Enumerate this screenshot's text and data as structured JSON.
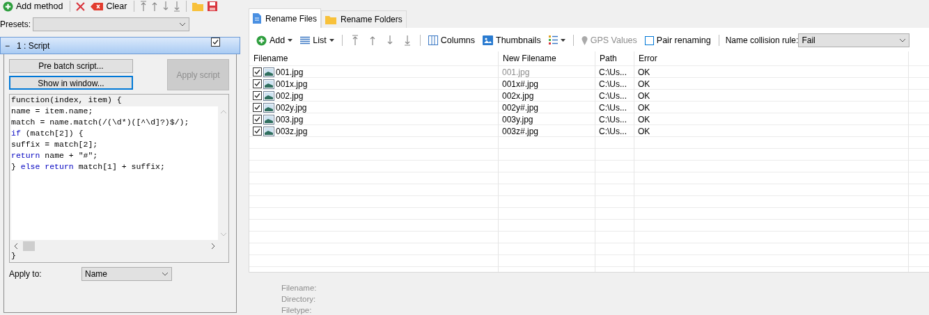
{
  "left_toolbar": {
    "add_method": "Add method",
    "clear": "Clear"
  },
  "presets": {
    "label": "Presets:"
  },
  "method": {
    "toggle": "−",
    "title": "1 : Script",
    "enabled": true,
    "buttons": [
      {
        "label": "Pre batch script...",
        "focused": false
      },
      {
        "label": "Show in window...",
        "focused": true
      }
    ],
    "apply_script": {
      "label": "Apply script",
      "disabled": true
    },
    "code_lines": [
      [
        {
          "text": "function(index, item) {"
        }
      ],
      [
        {
          "text": "name = item.name;"
        }
      ],
      [
        {
          "text": "match = name.match(/(\\d*)([^\\d]?)$/);"
        }
      ],
      [
        {
          "text": "if",
          "keyword": true
        },
        {
          "text": " (match[2]) {"
        }
      ],
      [
        {
          "text": "suffix = match[2];"
        }
      ],
      [
        {
          "text": "return",
          "keyword": true
        },
        {
          "text": " name + \"#\";"
        }
      ],
      [
        {
          "text": "} "
        },
        {
          "text": "else return",
          "keyword": true
        },
        {
          "text": " match[1] + suffix;"
        }
      ],
      [
        {
          "text": "}"
        }
      ]
    ],
    "apply_to": {
      "label": "Apply to:",
      "value": "Name"
    }
  },
  "tabs": [
    {
      "label": "Rename Files",
      "selected": true,
      "kind": "file"
    },
    {
      "label": "Rename Folders",
      "selected": false,
      "kind": "folder"
    }
  ],
  "toolbar": {
    "add": "Add",
    "list": "List",
    "columns": "Columns",
    "thumbnails": "Thumbnails",
    "gps": {
      "label": "GPS Values",
      "disabled": true
    },
    "pair_renaming": {
      "label": "Pair renaming",
      "checked": false
    },
    "collision": {
      "label": "Name collision rule:",
      "value": "Fail"
    }
  },
  "table": {
    "columns": [
      "Filename",
      "New Filename",
      "Path",
      "Error"
    ],
    "rows": [
      {
        "checked": true,
        "filename": "001.jpg",
        "new_filename": "001.jpg",
        "unchanged": true,
        "path": "C:\\Us...",
        "error": "OK"
      },
      {
        "checked": true,
        "filename": "001x.jpg",
        "new_filename": "001x#.jpg",
        "unchanged": false,
        "path": "C:\\Us...",
        "error": "OK"
      },
      {
        "checked": true,
        "filename": "002.jpg",
        "new_filename": "002x.jpg",
        "unchanged": false,
        "path": "C:\\Us...",
        "error": "OK"
      },
      {
        "checked": true,
        "filename": "002y.jpg",
        "new_filename": "002y#.jpg",
        "unchanged": false,
        "path": "C:\\Us...",
        "error": "OK"
      },
      {
        "checked": true,
        "filename": "003.jpg",
        "new_filename": "003y.jpg",
        "unchanged": false,
        "path": "C:\\Us...",
        "error": "OK"
      },
      {
        "checked": true,
        "filename": "003z.jpg",
        "new_filename": "003z#.jpg",
        "unchanged": false,
        "path": "C:\\Us...",
        "error": "OK"
      }
    ]
  },
  "details": [
    "Filename:",
    "Directory:",
    "Filetype:"
  ]
}
